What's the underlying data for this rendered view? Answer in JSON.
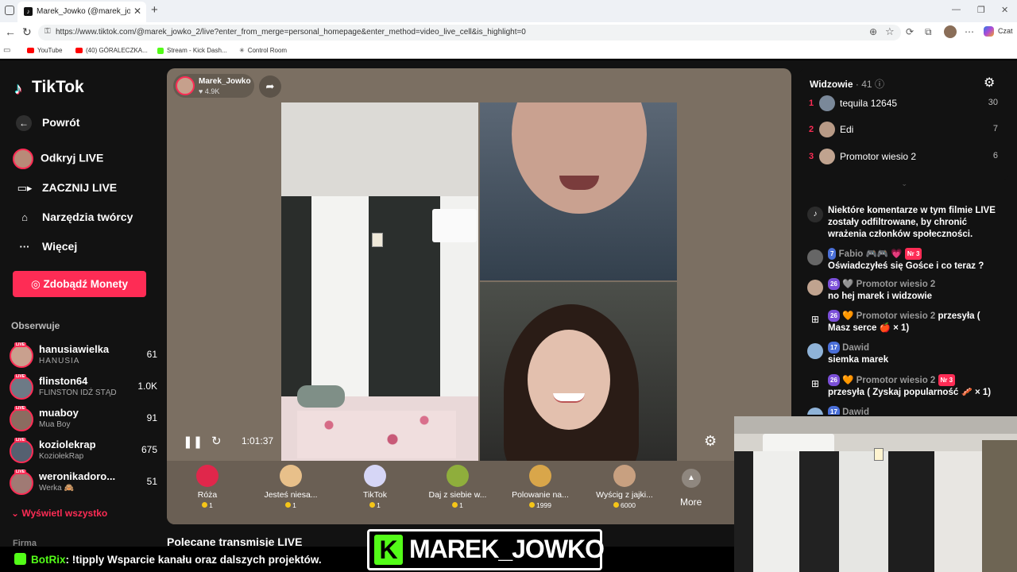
{
  "browser": {
    "tab_title": "Marek_Jowko (@marek_jowko_2) |",
    "tab_favicon_char": "♪",
    "url": "https://www.tiktok.com/@marek_jowko_2/live?enter_from_merge=personal_homepage&enter_method=video_live_cell&is_highlight=0",
    "czat_label": "Czat",
    "bookmarks": [
      "YouTube",
      "(40) GÓRALECZKA...",
      "Stream - Kick Dash...",
      "Control Room"
    ]
  },
  "sidebar": {
    "logo": "TikTok",
    "logo_icon": "♪",
    "nav": [
      "Powrót",
      "Odkryj LIVE",
      "ZACZNIJ LIVE",
      "Narzędzia twórcy",
      "Więcej"
    ],
    "coins_button": "Zdobądź Monety",
    "following_heading": "Obserwuje",
    "following": [
      {
        "name": "hanusiawielka",
        "sub": "HANUSIA",
        "count": "61",
        "color": "#c9a08e"
      },
      {
        "name": "flinston64",
        "sub": "FLINSTON IDŹ STĄD",
        "count": "1.0K",
        "color": "#6d7a86"
      },
      {
        "name": "muaboy",
        "sub": "Mua Boy",
        "count": "91",
        "color": "#8b6c60"
      },
      {
        "name": "koziolekrap",
        "sub": "KoziołekRap",
        "count": "675",
        "color": "#556070"
      },
      {
        "name": "weronikadoro...",
        "sub": "Werka 🙈",
        "count": "51",
        "color": "#a07a74"
      }
    ],
    "live_badge": "LIVE",
    "show_all": "Wyświetl wszystko",
    "company": "Firma"
  },
  "player": {
    "host_name": "Marek_Jowko",
    "host_likes": "♥ 4.9K",
    "timer": "1:01:37",
    "gifts": [
      {
        "name": "Róża",
        "price": "1",
        "color": "#e0274b"
      },
      {
        "name": "Jesteś niesa...",
        "price": "1",
        "color": "#e8c08a"
      },
      {
        "name": "TikTok",
        "price": "1",
        "color": "#d6d6f6"
      },
      {
        "name": "Daj z siebie w...",
        "price": "1",
        "color": "#8fae3c"
      },
      {
        "name": "Polowanie na...",
        "price": "1999",
        "color": "#d9a64a"
      },
      {
        "name": "Wyścig z jajki...",
        "price": "6000",
        "color": "#c8a080"
      }
    ],
    "more": "More"
  },
  "recommended": "Polecane transmisje LIVE",
  "viewers": {
    "title": "Widzowie",
    "count": "· 41",
    "rows": [
      {
        "rank": "1",
        "name": "tequila 12645",
        "score": "30",
        "color": "#7a8899"
      },
      {
        "rank": "2",
        "name": "Edi",
        "score": "7",
        "color": "#b89a86"
      },
      {
        "rank": "3",
        "name": "Promotor wiesio 2",
        "score": "6",
        "color": "#c0a38f"
      }
    ]
  },
  "chat": {
    "notice": "Niektóre komentarze w tym filmie LIVE zostały odfiltrowane, by chronić wrażenia członków społeczności.",
    "messages": [
      {
        "level": "7",
        "user": "Fabio 🎮🎮 💗",
        "badge": "Nr 3",
        "text": "Oświadczyłeś się Gośce i co teraz ?",
        "color": "#666"
      },
      {
        "level": "26",
        "user": "🩶 Promotor wiesio 2",
        "badge": "",
        "text": "no hej marek i widzowie",
        "color": "#c0a38f"
      },
      {
        "level": "26",
        "user": "🧡 Promotor wiesio 2",
        "badge": "",
        "text": "przesyła ( Masz serce 🍎 × 1)",
        "color": ""
      },
      {
        "level": "17",
        "user": "Dawid",
        "badge": "",
        "text": "siemka marek",
        "color": "#8fb3d8"
      },
      {
        "level": "26",
        "user": "🧡 Promotor wiesio 2",
        "badge": "Nr 3",
        "text": "przesyła ( Zyskaj popularność 🥓 × 1)",
        "color": ""
      },
      {
        "level": "17",
        "user": "Dawid",
        "badge": "",
        "text": "",
        "color": "#8fb3d8"
      }
    ]
  },
  "overlay": {
    "bot_name": "BotRix",
    "bot_text": ": !tipply Wsparcie kanału oraz dalszych projektów.",
    "kick_letter": "K",
    "kick_name": "MAREK_JOWKO"
  }
}
